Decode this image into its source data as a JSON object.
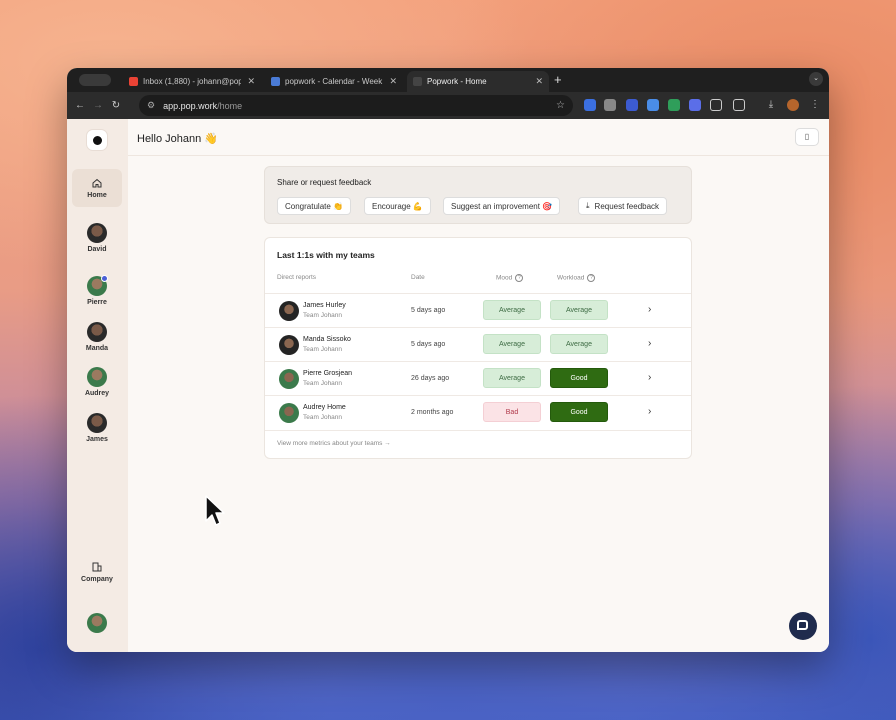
{
  "browser": {
    "tabs": [
      {
        "title": "Inbox (1,880) - johann@pop.",
        "favicon_color": "#ea4335",
        "active": false
      },
      {
        "title": "popwork - Calendar - Week o",
        "favicon_color": "#4a7bd6",
        "active": false
      },
      {
        "title": "Popwork - Home",
        "favicon_color": "#222222",
        "active": true
      }
    ],
    "new_tab": "+",
    "url_host": "app.pop.work",
    "url_path": "/home"
  },
  "sidebar": {
    "items": [
      {
        "label": "Home",
        "icon": "home-icon"
      },
      {
        "label": "David",
        "icon": "avatar"
      },
      {
        "label": "Pierre",
        "icon": "avatar"
      },
      {
        "label": "Manda",
        "icon": "avatar"
      },
      {
        "label": "Audrey",
        "icon": "avatar"
      },
      {
        "label": "James",
        "icon": "avatar"
      }
    ],
    "company_label": "Company"
  },
  "header": {
    "greeting": "Hello Johann 👋"
  },
  "feedback": {
    "title": "Share or request feedback",
    "buttons": {
      "congratulate": "Congratulate 👏",
      "encourage": "Encourage 💪",
      "suggest": "Suggest an improvement 🎯",
      "request": "Request feedback"
    }
  },
  "one_on_ones": {
    "title": "Last 1:1s with my teams",
    "columns": {
      "reports": "Direct reports",
      "date": "Date",
      "mood": "Mood",
      "workload": "Workload"
    },
    "rows": [
      {
        "name": "James Hurley",
        "team": "Team Johann",
        "date": "5 days ago",
        "mood": "Average",
        "workload": "Average"
      },
      {
        "name": "Manda Sissoko",
        "team": "Team Johann",
        "date": "5 days ago",
        "mood": "Average",
        "workload": "Average"
      },
      {
        "name": "Pierre Grosjean",
        "team": "Team Johann",
        "date": "26 days ago",
        "mood": "Average",
        "workload": "Good"
      },
      {
        "name": "Audrey Home",
        "team": "Team Johann",
        "date": "2 months ago",
        "mood": "Bad",
        "workload": "Good"
      }
    ],
    "more_link": "View more metrics about your teams →"
  },
  "colors": {
    "average_bg": "#d7edd8",
    "good_bg": "#2f6b12",
    "bad_bg": "#fbe3e6",
    "sidebar_bg": "#f4ebe4"
  }
}
